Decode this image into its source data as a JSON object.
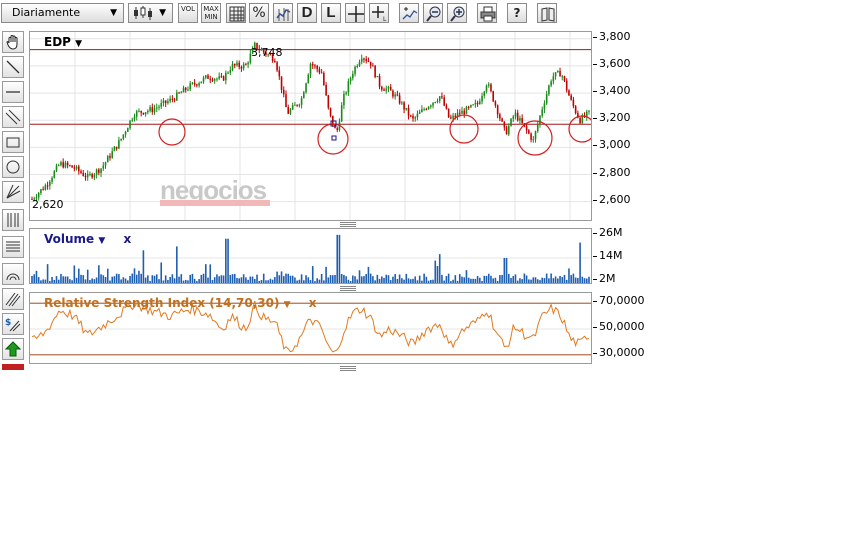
{
  "toolbar": {
    "period_label": "Diariamente",
    "vol_label": "VOL",
    "maxmin_label": "MAX MIN",
    "percent_label": "%",
    "d_label": "D",
    "l_label": "L",
    "help_label": "?"
  },
  "main_chart": {
    "symbol": "EDP",
    "max_label": "3,748",
    "min_label": "2,620",
    "watermark": "negocios",
    "y_ticks": [
      "3,800",
      "3,600",
      "3,400",
      "3,200",
      "3,000",
      "2,800",
      "2,600"
    ],
    "y_range": [
      2.45,
      3.85
    ],
    "resistance_level": 3.72,
    "support_level": 3.17,
    "colors": {
      "up": "#1a8a1a",
      "down": "#c00000",
      "lines": "#a01818",
      "circles": "#d02020"
    }
  },
  "volume_panel": {
    "title": "Volume",
    "close_label": "x",
    "y_ticks": [
      "26M",
      "14M",
      "2M"
    ],
    "color": "#1f5fb0"
  },
  "rsi_panel": {
    "title": "Relative Strength Index (14,70,30)",
    "close_label": "x",
    "y_ticks": [
      "70,0000",
      "50,0000",
      "30,0000"
    ],
    "upper": 70,
    "lower": 30,
    "color": "#e07a20",
    "band_color": "#b0704a"
  },
  "chart_data": [
    {
      "type": "candlestick",
      "title": "EDP",
      "ylim": [
        2.45,
        3.85
      ],
      "x": [
        0,
        15,
        30,
        45,
        60,
        75,
        95,
        110,
        130,
        150,
        170,
        190,
        205,
        215,
        230,
        240,
        250,
        262,
        275,
        290,
        300,
        312,
        320,
        328,
        335,
        345,
        355,
        365,
        375,
        385,
        395,
        410,
        425,
        440,
        450,
        460,
        470,
        480,
        490,
        500,
        510,
        520,
        530,
        540,
        550,
        560,
        570,
        580,
        590,
        600
      ],
      "y": [
        2.62,
        2.72,
        2.88,
        2.85,
        2.78,
        2.85,
        3.05,
        3.25,
        3.28,
        3.35,
        3.45,
        3.52,
        3.5,
        3.6,
        3.6,
        3.75,
        3.7,
        3.65,
        3.25,
        3.35,
        3.62,
        3.55,
        3.25,
        3.1,
        3.35,
        3.55,
        3.68,
        3.62,
        3.45,
        3.42,
        3.35,
        3.2,
        3.3,
        3.38,
        3.2,
        3.25,
        3.28,
        3.32,
        3.48,
        3.3,
        3.1,
        3.25,
        3.15,
        3.05,
        3.3,
        3.52,
        3.55,
        3.35,
        3.2,
        3.25
      ]
    },
    {
      "type": "bar",
      "title": "Volume",
      "ylim": [
        0,
        28
      ],
      "spikes": [
        [
          120,
          18
        ],
        [
          155,
          20
        ],
        [
          210,
          24
        ],
        [
          330,
          26
        ],
        [
          440,
          16
        ],
        [
          510,
          14
        ],
        [
          590,
          22
        ]
      ]
    },
    {
      "type": "line",
      "title": "Relative Strength Index (14,70,30)",
      "ylim": [
        22,
        78
      ],
      "x": [
        0,
        15,
        30,
        45,
        60,
        75,
        95,
        110,
        130,
        150,
        170,
        190,
        205,
        215,
        230,
        240,
        250,
        262,
        275,
        290,
        300,
        312,
        320,
        328,
        335,
        345,
        355,
        365,
        375,
        385,
        395,
        410,
        425,
        440,
        450,
        460,
        470,
        480,
        490,
        500,
        510,
        520,
        530,
        540,
        550,
        560,
        570,
        580,
        590,
        600
      ],
      "y": [
        40,
        48,
        65,
        60,
        45,
        52,
        62,
        70,
        64,
        60,
        66,
        62,
        50,
        60,
        50,
        68,
        58,
        55,
        30,
        44,
        58,
        50,
        34,
        30,
        48,
        62,
        66,
        58,
        44,
        50,
        46,
        38,
        50,
        54,
        36,
        46,
        52,
        56,
        66,
        48,
        34,
        52,
        46,
        42,
        60,
        66,
        60,
        42,
        38,
        46
      ]
    }
  ]
}
